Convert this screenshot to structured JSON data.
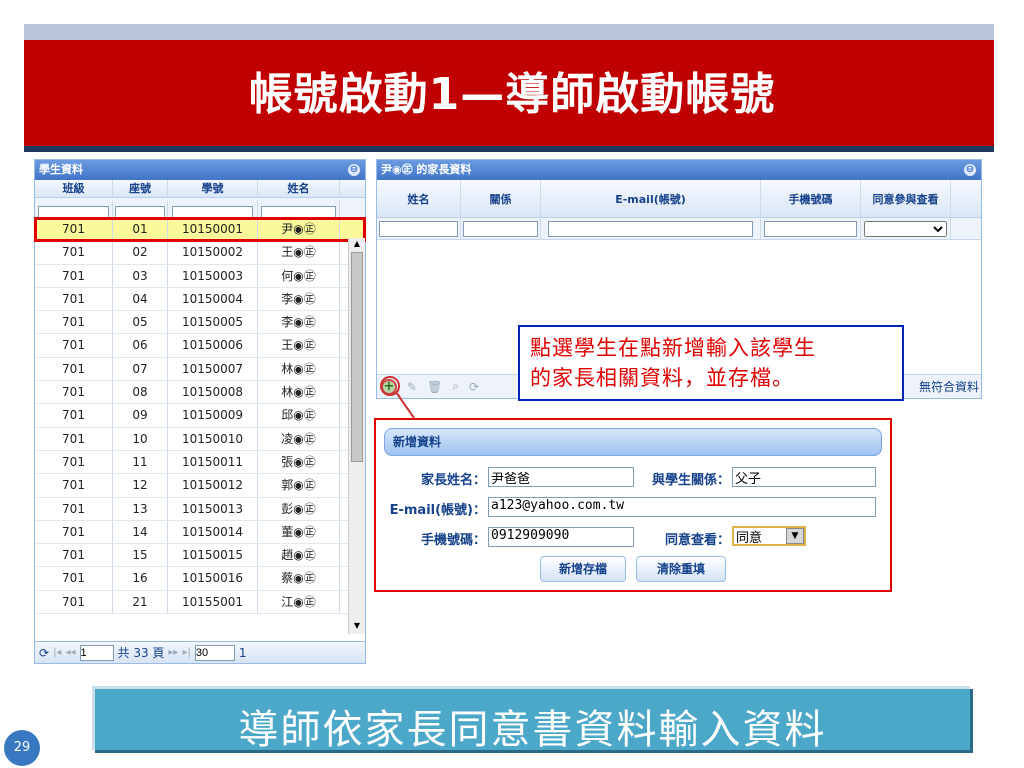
{
  "slide": {
    "title": "帳號啟動1—導師啟動帳號",
    "page_number": "29",
    "banner": "導師依家長同意書資料輸入資料"
  },
  "student_panel": {
    "title": "學生資料",
    "columns": [
      "班級",
      "座號",
      "學號",
      "姓名"
    ],
    "rows": [
      [
        "701",
        "01",
        "10150001",
        "尹◉㊣"
      ],
      [
        "701",
        "02",
        "10150002",
        "王◉㊣"
      ],
      [
        "701",
        "03",
        "10150003",
        "何◉㊣"
      ],
      [
        "701",
        "04",
        "10150004",
        "李◉㊣"
      ],
      [
        "701",
        "05",
        "10150005",
        "李◉㊣"
      ],
      [
        "701",
        "06",
        "10150006",
        "王◉㊣"
      ],
      [
        "701",
        "07",
        "10150007",
        "林◉㊣"
      ],
      [
        "701",
        "08",
        "10150008",
        "林◉㊣"
      ],
      [
        "701",
        "09",
        "10150009",
        "邱◉㊣"
      ],
      [
        "701",
        "10",
        "10150010",
        "凌◉㊣"
      ],
      [
        "701",
        "11",
        "10150011",
        "張◉㊣"
      ],
      [
        "701",
        "12",
        "10150012",
        "郭◉㊣"
      ],
      [
        "701",
        "13",
        "10150013",
        "彭◉㊣"
      ],
      [
        "701",
        "14",
        "10150014",
        "董◉㊣"
      ],
      [
        "701",
        "15",
        "10150015",
        "趙◉㊣"
      ],
      [
        "701",
        "16",
        "10150016",
        "蔡◉㊣"
      ],
      [
        "701",
        "21",
        "10155001",
        "江◉㊣"
      ]
    ],
    "pager": {
      "page": "1",
      "total_text": "共 33 頁",
      "page_size": "30",
      "info": "1"
    }
  },
  "parent_panel": {
    "title": "尹◉㊣ 的家長資料",
    "columns": [
      "姓名",
      "關係",
      "E-mail(帳號)",
      "手機號碼",
      "同意參與查看"
    ],
    "no_match": "無符合資料"
  },
  "callout": {
    "line1": "點選學生在點新增輸入該學生",
    "line2": "的家長相關資料，並存檔。"
  },
  "add_form": {
    "title": "新增資料",
    "parent_name_label": "家長姓名：",
    "parent_name_value": "尹爸爸",
    "relation_label": "與學生關係：",
    "relation_value": "父子",
    "email_label": "E-mail(帳號)：",
    "email_value": "a123@yahoo.com.tw",
    "phone_label": "手機號碼：",
    "phone_value": "0912909090",
    "consent_label": "同意查看：",
    "consent_value": "同意",
    "save_button": "新增存檔",
    "clear_button": "清除重填"
  }
}
